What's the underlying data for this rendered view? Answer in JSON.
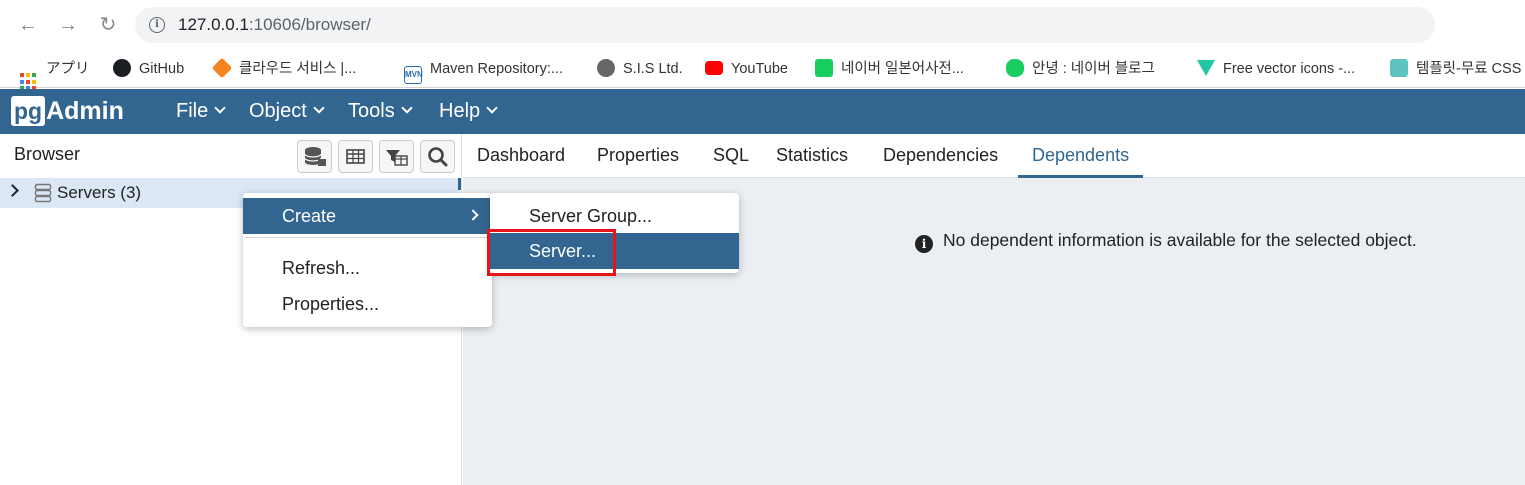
{
  "chrome": {
    "url_host": "127.0.0.1",
    "url_rest": ":10606/browser/",
    "bookmarks": [
      {
        "label": "アプリ",
        "icon": "apps-grid-icon"
      },
      {
        "label": "GitHub",
        "icon": "github-icon"
      },
      {
        "label": "클라우드 서비스 |...",
        "icon": "cloud-cube-icon"
      },
      {
        "label": "Maven Repository:...",
        "icon": "maven-icon"
      },
      {
        "label": "S.I.S Ltd.",
        "icon": "globe-icon"
      },
      {
        "label": "YouTube",
        "icon": "youtube-icon"
      },
      {
        "label": "네이버 일본어사전...",
        "icon": "naver-dictionary-icon"
      },
      {
        "label": "안녕 : 네이버 블로그",
        "icon": "naver-blog-icon"
      },
      {
        "label": "Free vector icons -...",
        "icon": "vector-icons-icon"
      },
      {
        "label": "템플릿-무료 CSS",
        "icon": "template-icon"
      }
    ]
  },
  "app": {
    "logo_pg": "pg",
    "logo_admin": "Admin",
    "menus": [
      "File",
      "Object",
      "Tools",
      "Help"
    ],
    "accent": "#326690"
  },
  "browser": {
    "title": "Browser",
    "toolbar_icons": [
      "database-icon",
      "table-icon",
      "filtered-rows-icon",
      "search-icon"
    ],
    "tree": {
      "label": "Servers (3)"
    }
  },
  "tabs": {
    "items": [
      "Dashboard",
      "Properties",
      "SQL",
      "Statistics",
      "Dependencies",
      "Dependents"
    ],
    "active": "Dependents"
  },
  "main": {
    "message": "No dependent information is available for the selected object."
  },
  "context_menu": {
    "items": [
      "Create",
      "Refresh...",
      "Properties..."
    ]
  },
  "submenu": {
    "items": [
      "Server Group...",
      "Server..."
    ],
    "highlighted": "Server..."
  },
  "highlight_color": "#e8141c"
}
